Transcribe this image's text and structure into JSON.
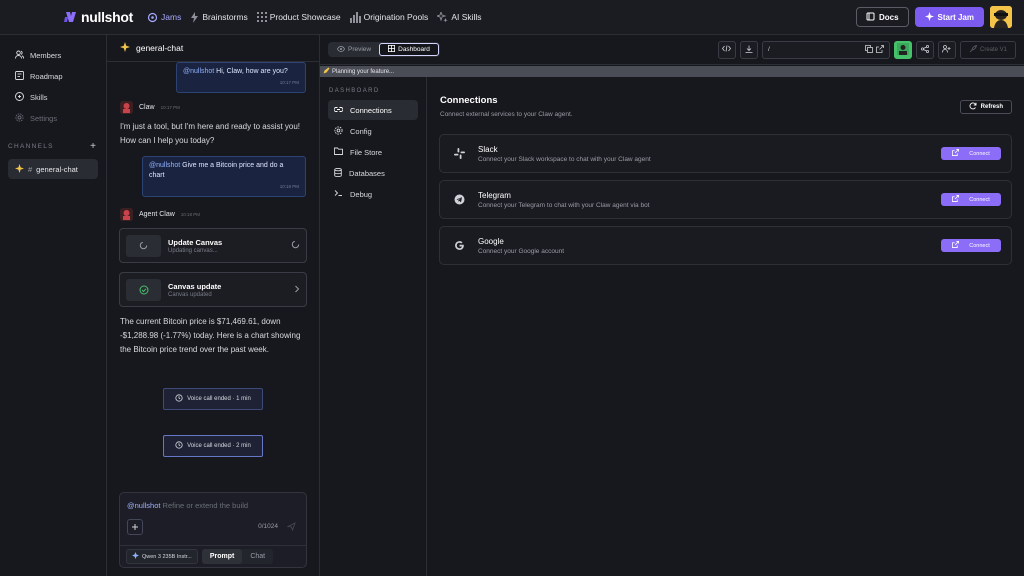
{
  "app": {
    "brand": "nullshot",
    "nav": [
      {
        "label": "Jams",
        "icon": "jams-icon",
        "active": true
      },
      {
        "label": "Brainstorms",
        "icon": "bolt-icon",
        "active": false
      },
      {
        "label": "Product Showcase",
        "icon": "grid-icon",
        "active": false
      },
      {
        "label": "Origination Pools",
        "icon": "bar-chart-icon",
        "active": false
      },
      {
        "label": "AI Skills",
        "icon": "sparkles-icon",
        "active": false
      }
    ],
    "docs_label": "Docs",
    "start_jam_label": "Start Jam",
    "accent": "#7c5cf0"
  },
  "sidebar": {
    "items": [
      {
        "label": "Members",
        "icon": "members-icon"
      },
      {
        "label": "Roadmap",
        "icon": "roadmap-icon"
      },
      {
        "label": "Skills",
        "icon": "skills-icon"
      },
      {
        "label": "Settings",
        "icon": "settings-icon"
      }
    ],
    "channels_heading": "CHANNELS",
    "add_label": "+",
    "channel": {
      "hash": "#",
      "name": "general-chat"
    }
  },
  "chat": {
    "header": "general-chat",
    "messages": {
      "u1_mention": "@nullshot",
      "u1_text": " Hi, Claw, how are you?",
      "u1_time": "10:17 PM",
      "a1_name": "Claw",
      "a1_time": "10:17 PM",
      "a1_text": "I'm just a tool, but I'm here and ready to assist you! How can I help you today?",
      "u2_mention": "@nullshot",
      "u2_text": " Give me a Bitcoin price and do a chart",
      "u2_time": "10:18 PM",
      "a2_name": "Agent Claw",
      "a2_time": "10:18 PM",
      "tool1_title": "Update Canvas",
      "tool1_sub": "Updating canvas...",
      "tool2_title": "Canvas update",
      "tool2_sub": "Canvas updated",
      "a2_text": "The current Bitcoin price is $71,469.61, down -$1,288.98 (-1.77%) today. Here is a chart showing the Bitcoin price trend over the past week.",
      "voice1": "Voice call ended · 1 min",
      "voice2": "Voice call ended · 2 min"
    },
    "composer": {
      "mention": "@nullshot",
      "placeholder": " Refine or extend the build",
      "counter": "0/1024",
      "model": "Qwen 3 235B Instr...",
      "tab_prompt": "Prompt",
      "tab_chat": "Chat"
    }
  },
  "workspace": {
    "tab_preview": "Preview",
    "tab_dashboard": "Dashboard",
    "url": "/",
    "create_label": "Create V1",
    "progress_text": "Planning your feature...",
    "dash_heading": "DASHBOARD",
    "dash_nav": [
      "Connections",
      "Config",
      "File Store",
      "Databases",
      "Debug"
    ],
    "main_title": "Connections",
    "main_sub": "Connect external services to your Claw agent.",
    "refresh_label": "Refresh",
    "connections": [
      {
        "name": "Slack",
        "desc": "Connect your Slack workspace to chat with your Claw agent",
        "button": "Connect",
        "icon": "slack-icon"
      },
      {
        "name": "Telegram",
        "desc": "Connect your Telegram to chat with your Claw agent via bot",
        "button": "Connect",
        "icon": "telegram-icon"
      },
      {
        "name": "Google",
        "desc": "Connect your Google account",
        "button": "Connect",
        "icon": "google-icon"
      }
    ]
  }
}
